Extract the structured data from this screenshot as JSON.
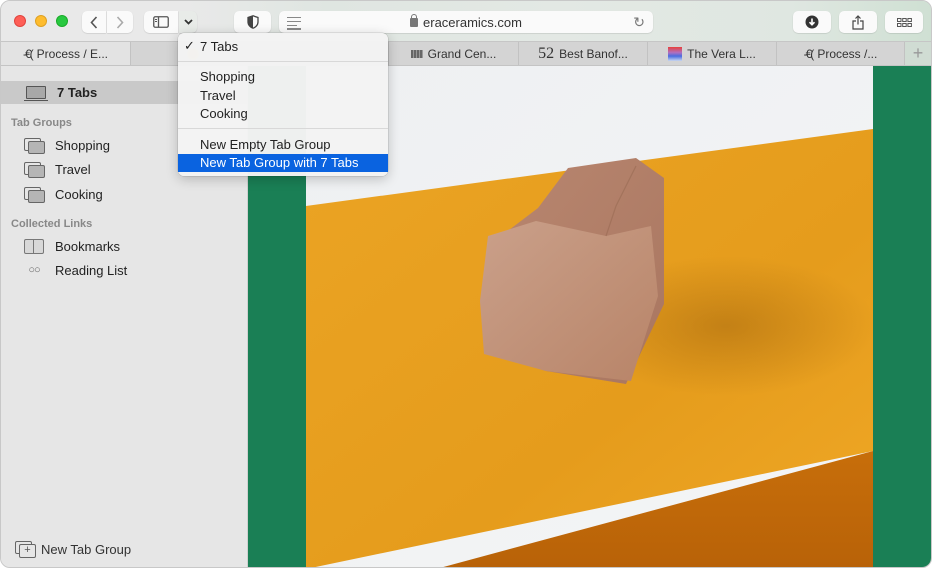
{
  "window": {
    "controls": [
      "close",
      "minimize",
      "zoom"
    ]
  },
  "toolbar": {
    "back_icon": "chevron-left",
    "forward_icon": "chevron-right",
    "sidebar_icon": "sidebar-toggle",
    "tab_group_chevron": "chevron-down",
    "privacy_icon": "shield",
    "reader_icon": "reader-lines",
    "url": "eraceramics.com",
    "reload_icon": "reload",
    "download_icon": "download-arrow-circle",
    "share_icon": "share",
    "tab_overview_icon": "grid"
  },
  "tabs": [
    {
      "title": "Process / E...",
      "favicon": "era-logo",
      "active": true
    },
    {
      "title": "",
      "favicon": "sun-logo",
      "active": false
    },
    {
      "title": "",
      "favicon": "",
      "active": false
    },
    {
      "title": "Grand Cen...",
      "favicon": "grand-central-logo",
      "active": false
    },
    {
      "title": "Best Banof...",
      "favicon": "52",
      "active": false
    },
    {
      "title": "The Vera L...",
      "favicon": "vera-gradient",
      "active": false
    },
    {
      "title": "Process /...",
      "favicon": "era-logo",
      "active": false
    }
  ],
  "new_tab_label": "+",
  "sidebar": {
    "current": "7 Tabs",
    "tab_groups_heading": "Tab Groups",
    "tab_groups": [
      "Shopping",
      "Travel",
      "Cooking"
    ],
    "collected_heading": "Collected Links",
    "collected": [
      {
        "label": "Bookmarks",
        "icon": "book"
      },
      {
        "label": "Reading List",
        "icon": "glasses"
      }
    ],
    "new_group_label": "New Tab Group"
  },
  "menu": {
    "checkmark": "✓",
    "current": "7 Tabs",
    "groups": [
      "Shopping",
      "Travel",
      "Cooking"
    ],
    "actions": [
      "New Empty Tab Group",
      "New Tab Group with 7 Tabs"
    ],
    "highlighted": "New Tab Group with 7 Tabs"
  },
  "colors": {
    "accent": "#0a63e0",
    "page_green": "#1a7f55",
    "pedestal_orange": "#e8a020",
    "clay": "#c08a6e"
  }
}
